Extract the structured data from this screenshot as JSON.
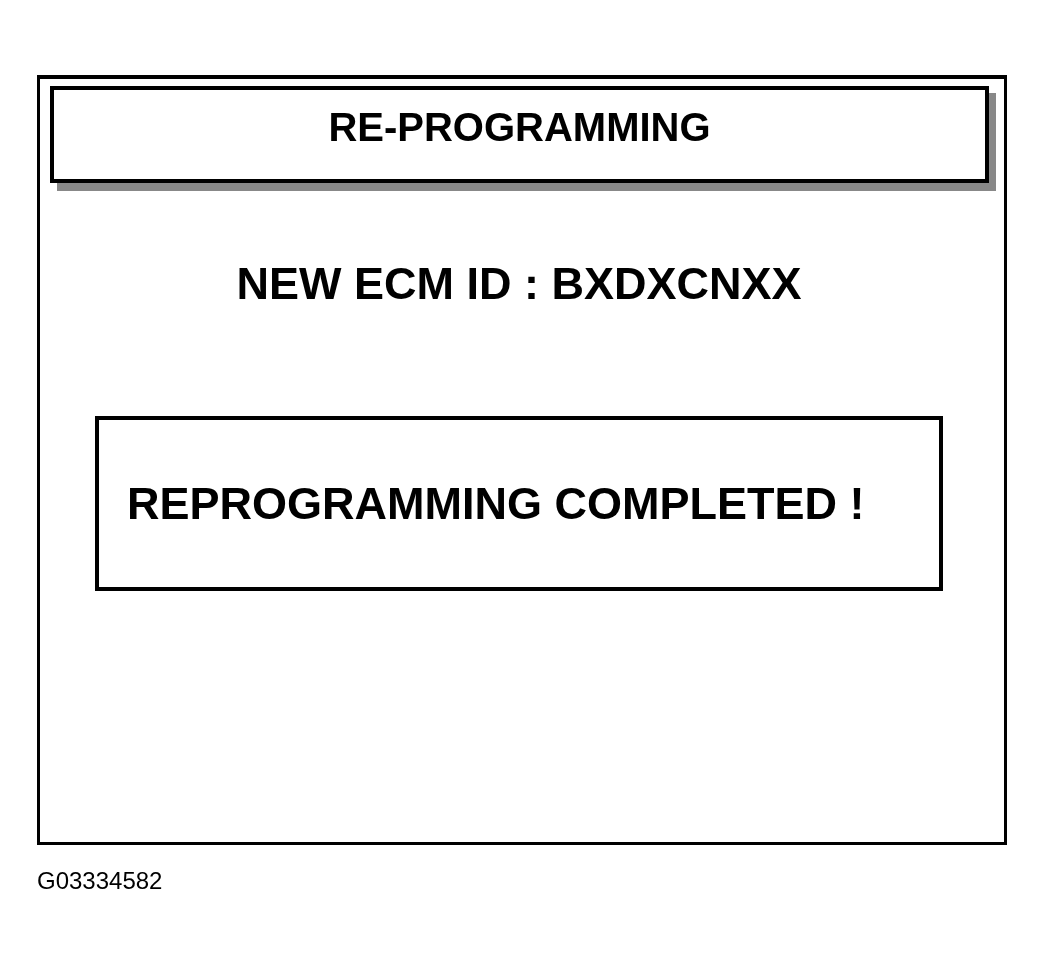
{
  "screen": {
    "title": "RE-PROGRAMMING",
    "ecm_id_line": "NEW ECM ID : BXDXCNXX",
    "message": "REPROGRAMMING COMPLETED !"
  },
  "figure_code": "G03334582"
}
